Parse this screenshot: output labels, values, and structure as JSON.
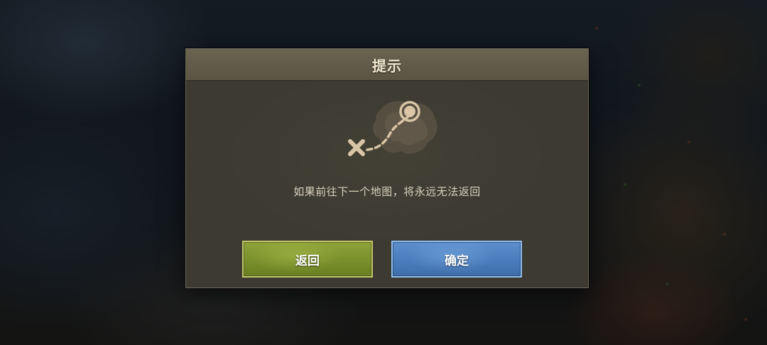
{
  "dialog": {
    "title": "提示",
    "message": "如果前往下一个地图，将永远无法返回",
    "illustration_icon": "treasure-map-route-icon",
    "buttons": {
      "back_label": "返回",
      "confirm_label": "确定"
    }
  },
  "colors": {
    "back_button": "#7f942f",
    "confirm_button": "#4f80c0",
    "panel": "#3c3a31",
    "header": "#625b49",
    "title_text": "#f1e7cf",
    "icon_beige": "#d9c6a6"
  }
}
